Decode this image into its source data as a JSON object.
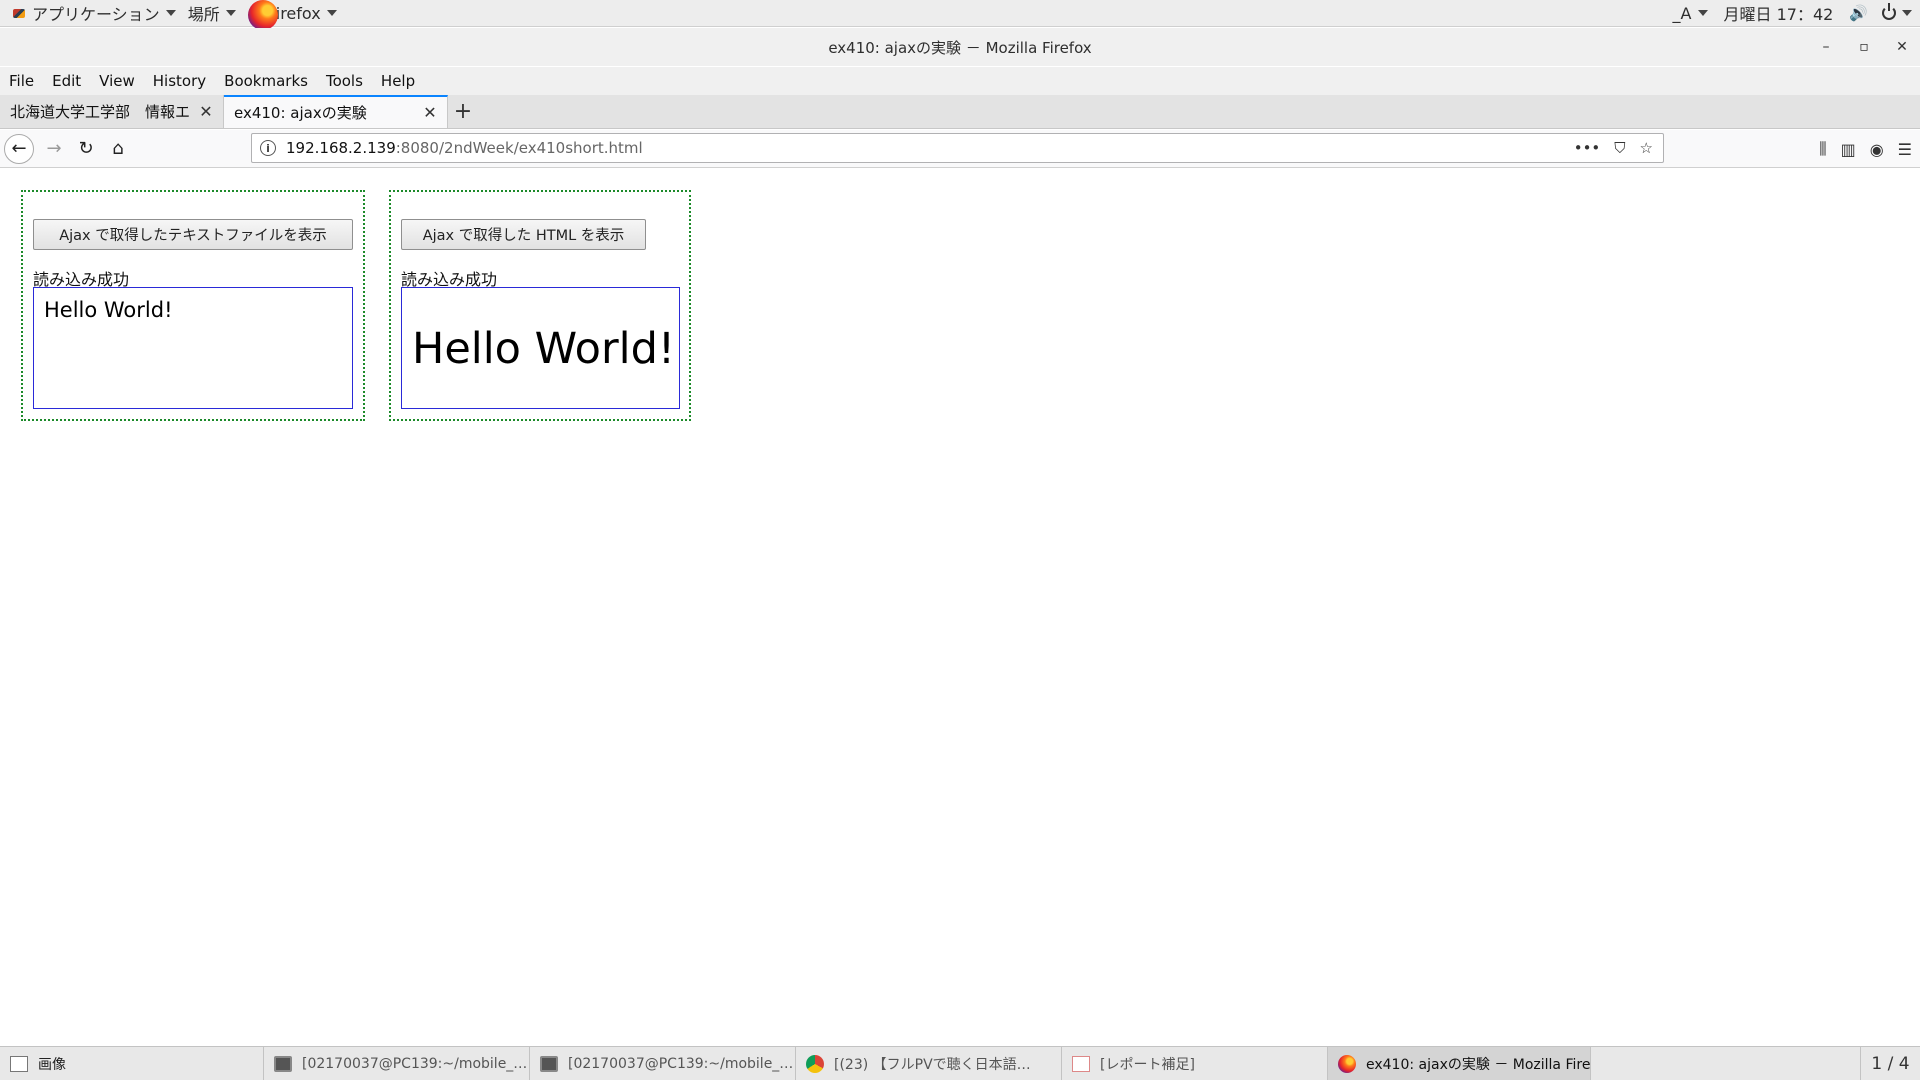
{
  "topbar": {
    "applications": "アプリケーション",
    "places": "場所",
    "firefox": "Firefox",
    "input_method": "_A",
    "datetime": "月曜日 17：42"
  },
  "window": {
    "title": "ex410: ajaxの実験 － Mozilla Firefox"
  },
  "menubar": [
    "File",
    "Edit",
    "View",
    "History",
    "Bookmarks",
    "Tools",
    "Help"
  ],
  "tabs": [
    {
      "label": "北海道大学工学部　情報エ"
    },
    {
      "label": "ex410: ajaxの実験"
    }
  ],
  "urlbar": {
    "host": "192.168.2.139",
    "rest": ":8080/2ndWeek/ex410short.html"
  },
  "panels": {
    "left": {
      "button": "Ajax で取得したテキストファイルを表示",
      "status": "読み込み成功",
      "output": "Hello World!"
    },
    "right": {
      "button": "Ajax で取得した HTML を表示",
      "status": "読み込み成功",
      "output": "Hello World!"
    }
  },
  "taskbar": {
    "items": [
      {
        "label": "画像",
        "icon": "image-icon"
      },
      {
        "label": "[02170037@PC139:~/mobile_…",
        "icon": "terminal-icon"
      },
      {
        "label": "[02170037@PC139:~/mobile_…",
        "icon": "terminal-icon"
      },
      {
        "label": "[(23) 【フルPVで聴く日本語…",
        "icon": "chrome-icon"
      },
      {
        "label": "[レポート補足]",
        "icon": "report-icon"
      },
      {
        "label": "ex410: ajaxの実験 － Mozilla Firefox",
        "icon": "firefox-icon"
      }
    ],
    "pager": "1 / 4"
  },
  "colors": {
    "panel_border": "#1c8a2a",
    "output_border": "#2a2ad8",
    "active_tab_accent": "#0a84ff"
  }
}
